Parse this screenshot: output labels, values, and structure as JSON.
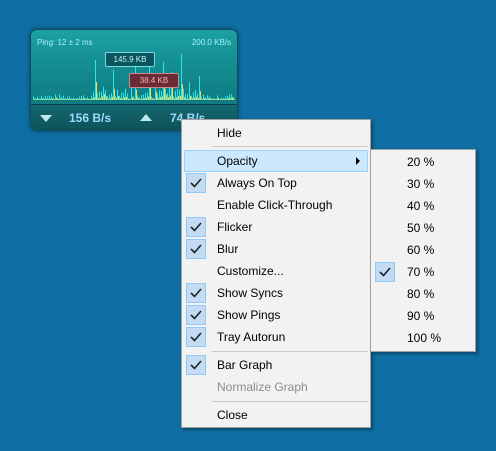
{
  "widget": {
    "ping_text": "Ping: 12 ± 2 ms",
    "max_rate": "200.0 KB/s",
    "peak_down": "145.9 KB",
    "peak_up": "38.4 KB",
    "download_rate": "156 B/s",
    "upload_rate": "74 B/s",
    "colors": {
      "graph_bg": "#1ca1a3",
      "download_bars": "#27e6ee",
      "upload_bars": "#ffd54a",
      "rate_text": "#9fd8ff"
    }
  },
  "context_menu": {
    "items": [
      {
        "label": "Hide",
        "checked": false,
        "disabled": false
      },
      {
        "label": "Opacity",
        "checked": false,
        "disabled": false,
        "submenu": true,
        "highlighted": true
      },
      {
        "label": "Always On Top",
        "checked": true,
        "disabled": false
      },
      {
        "label": "Enable Click-Through",
        "checked": false,
        "disabled": false
      },
      {
        "label": "Flicker",
        "checked": true,
        "disabled": false
      },
      {
        "label": "Blur",
        "checked": true,
        "disabled": false
      },
      {
        "label": "Customize...",
        "checked": false,
        "disabled": false
      },
      {
        "label": "Show Syncs",
        "checked": true,
        "disabled": false
      },
      {
        "label": "Show Pings",
        "checked": true,
        "disabled": false
      },
      {
        "label": "Tray Autorun",
        "checked": true,
        "disabled": false
      },
      {
        "label": "Bar Graph",
        "checked": true,
        "disabled": false
      },
      {
        "label": "Normalize Graph",
        "checked": false,
        "disabled": true
      },
      {
        "label": "Close",
        "checked": false,
        "disabled": false
      }
    ]
  },
  "opacity_submenu": {
    "items": [
      {
        "label": "20 %",
        "checked": false
      },
      {
        "label": "30 %",
        "checked": false
      },
      {
        "label": "40 %",
        "checked": false
      },
      {
        "label": "50 %",
        "checked": false
      },
      {
        "label": "60 %",
        "checked": false
      },
      {
        "label": "70 %",
        "checked": true
      },
      {
        "label": "80 %",
        "checked": false
      },
      {
        "label": "90 %",
        "checked": false
      },
      {
        "label": "100 %",
        "checked": false
      }
    ]
  },
  "icons": {
    "check": "check-icon",
    "submenu": "submenu-arrow-icon",
    "download": "download-arrow-icon",
    "upload": "upload-arrow-icon"
  }
}
